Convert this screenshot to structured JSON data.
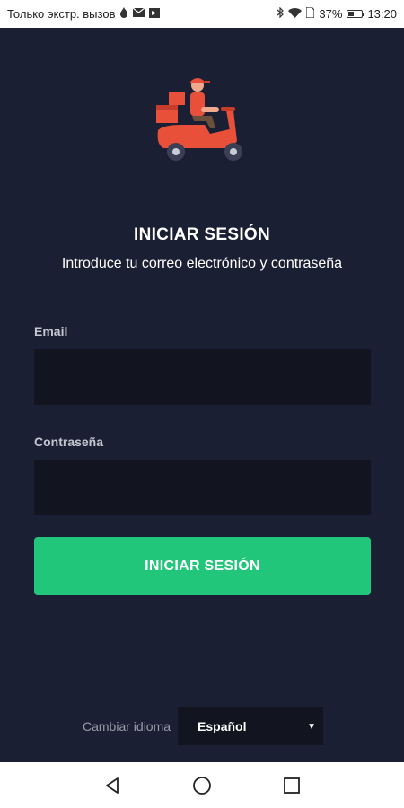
{
  "status_bar": {
    "carrier_text": "Только экстр. вызов",
    "battery_percent": "37%",
    "time": "13:20",
    "left_icons": [
      "flame-icon",
      "mail-icon",
      "cast-icon"
    ],
    "right_icons": [
      "bluetooth-icon",
      "wifi-icon",
      "sim-icon",
      "battery-icon"
    ]
  },
  "login": {
    "title": "INICIAR SESIÓN",
    "subtitle": "Introduce tu correo electrónico y contraseña",
    "email_label": "Email",
    "email_value": "",
    "password_label": "Contraseña",
    "password_value": "",
    "submit_label": "INICIAR SESIÓN"
  },
  "language": {
    "label": "Cambiar idioma",
    "selected": "Español"
  },
  "nav_bar": {
    "buttons": [
      "back-icon",
      "home-icon",
      "recents-icon"
    ]
  },
  "colors": {
    "background": "#1b1f33",
    "input_background": "#12141f",
    "accent": "#22c67a",
    "logo_red": "#e8503a"
  }
}
